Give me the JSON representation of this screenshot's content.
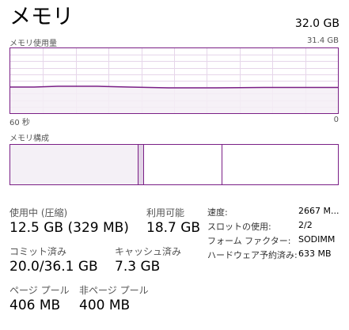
{
  "header": {
    "title": "メモリ",
    "total": "32.0 GB"
  },
  "usage_graph": {
    "label": "メモリ使用量",
    "max_label": "31.4 GB",
    "time_left": "60 秒",
    "time_right": "0",
    "colors": {
      "border": "#7a1f86",
      "line": "#7a1f86",
      "fill": "#f4eef6",
      "grid": "#e6d6ea"
    }
  },
  "composition": {
    "label": "メモリ構成",
    "segments": [
      {
        "name": "in-use",
        "fraction": 0.39,
        "color": "#f4f0f6"
      },
      {
        "name": "modified",
        "fraction": 0.016,
        "color": "#e2d4e6"
      },
      {
        "name": "standby",
        "fraction": 0.24,
        "color": "#ffffff"
      },
      {
        "name": "free",
        "fraction": 0.354,
        "color": "#ffffff"
      }
    ]
  },
  "stats": {
    "in_use": {
      "label": "使用中 (圧縮)",
      "value": "12.5 GB (329 MB)"
    },
    "available": {
      "label": "利用可能",
      "value": "18.7 GB"
    },
    "committed": {
      "label": "コミット済み",
      "value": "20.0/36.1 GB"
    },
    "cached": {
      "label": "キャッシュ済み",
      "value": "7.3 GB"
    },
    "paged_pool": {
      "label": "ページ プール",
      "value": "406 MB"
    },
    "non_paged_pool": {
      "label": "非ページ プール",
      "value": "400 MB"
    }
  },
  "details": [
    {
      "label": "速度:",
      "value": "2667 M..."
    },
    {
      "label": "スロットの使用:",
      "value": "2/2"
    },
    {
      "label": "フォーム ファクター:",
      "value": "SODIMM"
    },
    {
      "label": "ハードウェア予約済み:",
      "value": "633 MB"
    }
  ]
}
